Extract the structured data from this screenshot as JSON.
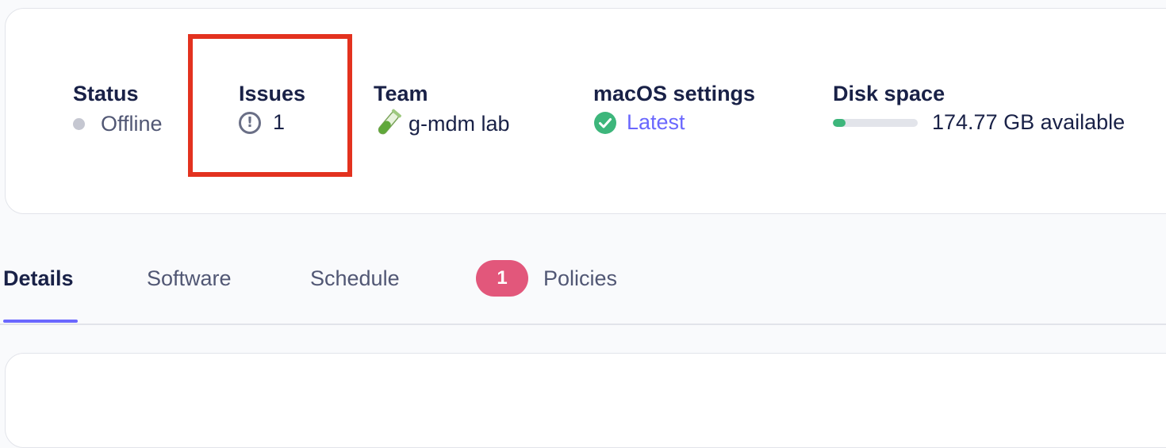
{
  "summary": {
    "status": {
      "label": "Status",
      "value": "Offline",
      "dot_color": "#c5c7d1"
    },
    "issues": {
      "label": "Issues",
      "icon": "alert-circle-icon",
      "count": "1",
      "highlighted": true
    },
    "team": {
      "label": "Team",
      "icon": "test-tube-icon",
      "name": "g-mdm lab"
    },
    "macos_settings": {
      "label": "macOS settings",
      "icon": "check-circle-icon",
      "value": "Latest"
    },
    "disk_space": {
      "label": "Disk space",
      "value": "174.77 GB available",
      "used_fraction": 0.15,
      "bar_color": "#3db67b"
    }
  },
  "tabs": [
    {
      "label": "Details",
      "active": true
    },
    {
      "label": "Software"
    },
    {
      "label": "Schedule"
    },
    {
      "label": "Policies",
      "badge": "1"
    }
  ],
  "colors": {
    "accent": "#6a67fe",
    "badge": "#e2577b",
    "highlight": "#e3321f",
    "success": "#3db67b"
  }
}
